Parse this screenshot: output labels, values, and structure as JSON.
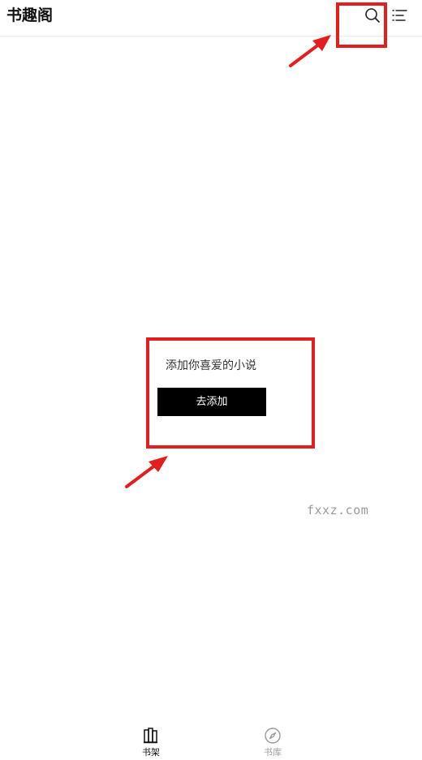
{
  "header": {
    "app_title": "书趣阁"
  },
  "empty_state": {
    "message": "添加你喜爱的小说",
    "add_button_label": "去添加"
  },
  "watermark": {
    "text": "fxxz.com"
  },
  "bottom_nav": {
    "items": [
      {
        "label": "书架",
        "icon": "bookshelf-icon",
        "active": true
      },
      {
        "label": "书库",
        "icon": "compass-icon",
        "active": false
      }
    ]
  },
  "colors": {
    "annotation": "#e31e1e",
    "button_bg": "#000000",
    "button_text": "#ffffff",
    "active_nav": "#111111",
    "inactive_nav": "#9a9a9a"
  }
}
